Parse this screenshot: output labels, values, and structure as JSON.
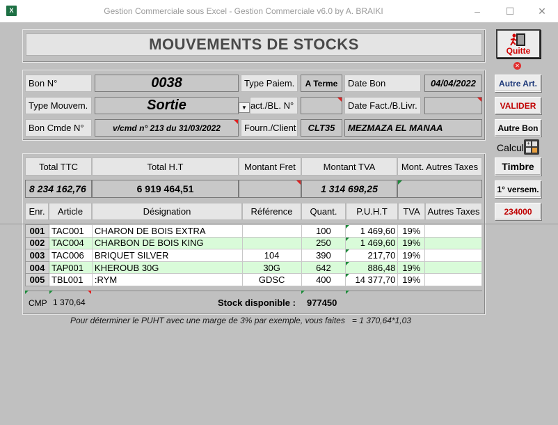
{
  "window": {
    "title": "Gestion Commerciale sous Excel - Gestion Commerciale v6.0  by A.  BRAIKI",
    "minimize": "–",
    "maximize": "☐",
    "close": "✕"
  },
  "header": {
    "title": "MOUVEMENTS DE STOCKS"
  },
  "quit": {
    "label": "Quitte",
    "close_badge": "✕"
  },
  "form": {
    "bon_label": "Bon N°",
    "bon_value": "0038",
    "type_paiem_label": "Type Paiem.",
    "type_paiem_value": "A Terme",
    "date_bon_label": "Date Bon",
    "date_bon_value": "04/04/2022",
    "type_mouv_label": "Type Mouvem.",
    "type_mouv_value": "Sortie",
    "fact_bl_label": "Fact./BL. N°",
    "date_fact_label": "Date Fact./B.Livr.",
    "bon_cmde_label": "Bon Cmde N°",
    "bon_cmde_value": "v/cmd n° 213 du 31/03/2022",
    "fourn_client_label": "Fourn./Client",
    "client_code": "CLT35",
    "client_name": "MEZMAZA EL MANAA"
  },
  "actions": {
    "autre_art": "Autre Art.",
    "valider": "VALIDER",
    "autre_bon": "Autre Bon",
    "calcul": "Calcul",
    "timbre": "Timbre",
    "premier_versem": "1° versem.",
    "versem_value": "234000"
  },
  "totals": {
    "headers": [
      "Total TTC",
      "Total H.T",
      "Montant Fret",
      "Montant TVA",
      "Mont. Autres Taxes"
    ],
    "ttc": "8 234 162,76",
    "ht": "6 919 464,51",
    "fret": "",
    "tva": "1 314 698,25",
    "autres": ""
  },
  "table": {
    "columns": [
      "Enr.",
      "Article",
      "Désignation",
      "Référence",
      "Quant.",
      "P.U.H.T",
      "TVA",
      "Autres Taxes"
    ],
    "rows": [
      {
        "enr": "001",
        "article": "TAC001",
        "designation": "CHARON DE BOIS EXTRA",
        "reference": "",
        "quant": "100",
        "puht": "1 469,60",
        "tva": "19%",
        "autres": ""
      },
      {
        "enr": "002",
        "article": "TAC004",
        "designation": "CHARBON DE BOIS KING",
        "reference": "",
        "quant": "250",
        "puht": "1 469,60",
        "tva": "19%",
        "autres": ""
      },
      {
        "enr": "003",
        "article": "TAC006",
        "designation": "BRIQUET SILVER",
        "reference": "104",
        "quant": "390",
        "puht": "217,70",
        "tva": "19%",
        "autres": ""
      },
      {
        "enr": "004",
        "article": "TAP001",
        "designation": "KHEROUB 30G",
        "reference": "30G",
        "quant": "642",
        "puht": "886,48",
        "tva": "19%",
        "autres": ""
      },
      {
        "enr": "005",
        "article": "TBL001",
        "designation": ":RYM",
        "reference": "GDSC",
        "quant": "400",
        "puht": "14 377,70",
        "tva": "19%",
        "autres": ""
      }
    ]
  },
  "footer": {
    "cmp_label": "CMP",
    "cmp_value": "1 370,64",
    "stock_label": "Stock disponible :",
    "stock_value": "977450",
    "note": "Pour déterminer le PUHT avec une marge de 3% par exemple, vous faites   = 1 370,64*1,03"
  },
  "colors": {
    "valider": "#c00000",
    "autre_art": "#1f3a7a",
    "versem": "#c00000",
    "title_text": "#4a4a4a"
  }
}
